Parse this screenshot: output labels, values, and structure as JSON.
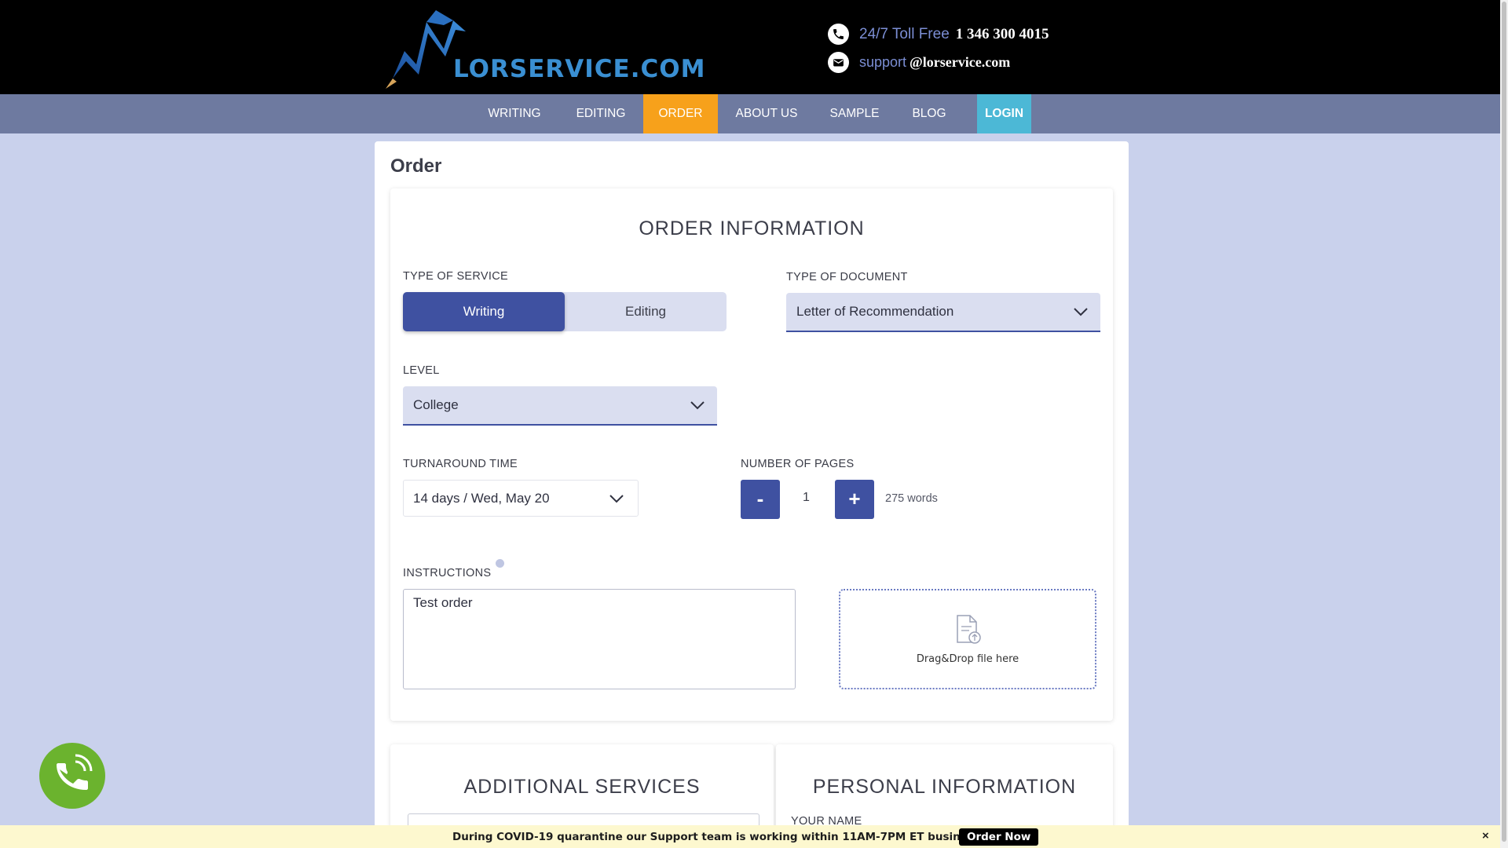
{
  "header": {
    "logo_text": "LORSERVICE.COM",
    "phone_label": "24/7 Toll Free",
    "phone_number": "1 346 300 4015",
    "email_label": "support",
    "email_value": "@lorservice.com"
  },
  "nav": {
    "items": [
      {
        "label": "WRITING"
      },
      {
        "label": "EDITING"
      },
      {
        "label": "ORDER"
      },
      {
        "label": "ABOUT US"
      },
      {
        "label": "SAMPLE"
      },
      {
        "label": "BLOG"
      },
      {
        "label": "LOGIN"
      }
    ],
    "active": "ORDER"
  },
  "page": {
    "title": "Order"
  },
  "order_info": {
    "title": "ORDER INFORMATION",
    "service": {
      "label": "TYPE OF SERVICE",
      "options": [
        "Writing",
        "Editing"
      ],
      "selected": "Writing"
    },
    "document": {
      "label": "TYPE OF DOCUMENT",
      "value": "Letter of Recommendation"
    },
    "level": {
      "label": "LEVEL",
      "value": "College"
    },
    "turnaround": {
      "label": "TURNAROUND TIME",
      "value": "14 days / Wed, May 20"
    },
    "pages": {
      "label": "NUMBER OF PAGES",
      "minus": "-",
      "plus": "+",
      "value": "1",
      "words": "275 words"
    },
    "instructions": {
      "label": "INSTRUCTIONS",
      "value": "Test order"
    },
    "dropzone": {
      "text": "Drag&Drop file here"
    }
  },
  "additional_services": {
    "title": "ADDITIONAL SERVICES"
  },
  "personal_info": {
    "title": "PERSONAL INFORMATION",
    "name_label": "YOUR NAME"
  },
  "banner": {
    "text": "During COVID-19 quarantine our Support team is working within 11AM-7PM ET business hours",
    "button": "Order Now",
    "close": "×"
  },
  "colors": {
    "accent": "#3f51a1",
    "nav_active": "#f7a11b",
    "login": "#4cb8d6",
    "call_button": "#6bb32e"
  },
  "icons": [
    "logo-pen-icon",
    "phone-icon",
    "mail-icon",
    "chevron-down-icon",
    "file-upload-icon",
    "info-icon",
    "call-icon",
    "close-icon"
  ]
}
